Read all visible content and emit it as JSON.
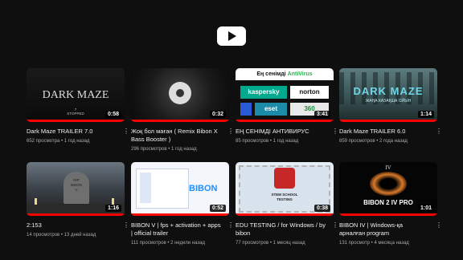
{
  "app": {
    "logo_icon": "youtube-play-icon"
  },
  "videos": [
    {
      "title": "Dark Maze TRAILER 7.0",
      "views": "652 просмотра",
      "age": "1 год назад",
      "duration": "0:58",
      "progress": 1.0,
      "thumb": {
        "big": "DARK MAZE",
        "small": "7\nSTOPPED"
      }
    },
    {
      "title": "Жоқ бол маған ( Remix Bibon X Bass Booster )",
      "views": "296 просмотров",
      "age": "1 год назад",
      "duration": "0:32",
      "progress": 1.0,
      "thumb": {}
    },
    {
      "title": "ЕҢ СЕНІМДІ АНТИВИРУС",
      "views": "85 просмотров",
      "age": "1 год назад",
      "duration": "3:41",
      "progress": 1.0,
      "thumb": {
        "header_pre": "Ең сенімді ",
        "header_accent": "AntiVirus",
        "kaspersky": "kaspersky",
        "norton": "norton",
        "eset": "eset",
        "n360": "360"
      }
    },
    {
      "title": "Dark Maze TRAILER 6.0",
      "views": "859 просмотров",
      "age": "2 года назад",
      "duration": "1:14",
      "progress": 1.0,
      "thumb": {
        "big": "DARK MAZE",
        "small": "ЖАҢА КАЗАҚША ОЙЫН"
      }
    },
    {
      "title": "2:153",
      "views": "14 просмотров",
      "age": "13 дней назад",
      "duration": "1:16",
      "progress": 1.0,
      "thumb": {
        "stone": "RIP\nBIBON\nV"
      }
    },
    {
      "title": "BIBON V | fps + activation + apps | official trailer",
      "views": "111 просмотров",
      "age": "2 недели назад",
      "duration": "0:52",
      "progress": 1.0,
      "thumb": {
        "brand": "BIBON"
      }
    },
    {
      "title": "EDU TESTING / for Windows / by bibon",
      "views": "77 просмотров",
      "age": "1 месяц назад",
      "duration": "0:38",
      "progress": 1.0,
      "thumb": {
        "txt": "STEM SCHOOL\nTESTING"
      }
    },
    {
      "title": "BIBON IV | Windows-қа арналған program",
      "views": "131 просмотр",
      "age": "4 месяца назад",
      "duration": "1:01",
      "progress": 1.0,
      "thumb": {
        "iv": "IV",
        "big": "BIBON  2  IV PRO"
      }
    }
  ]
}
